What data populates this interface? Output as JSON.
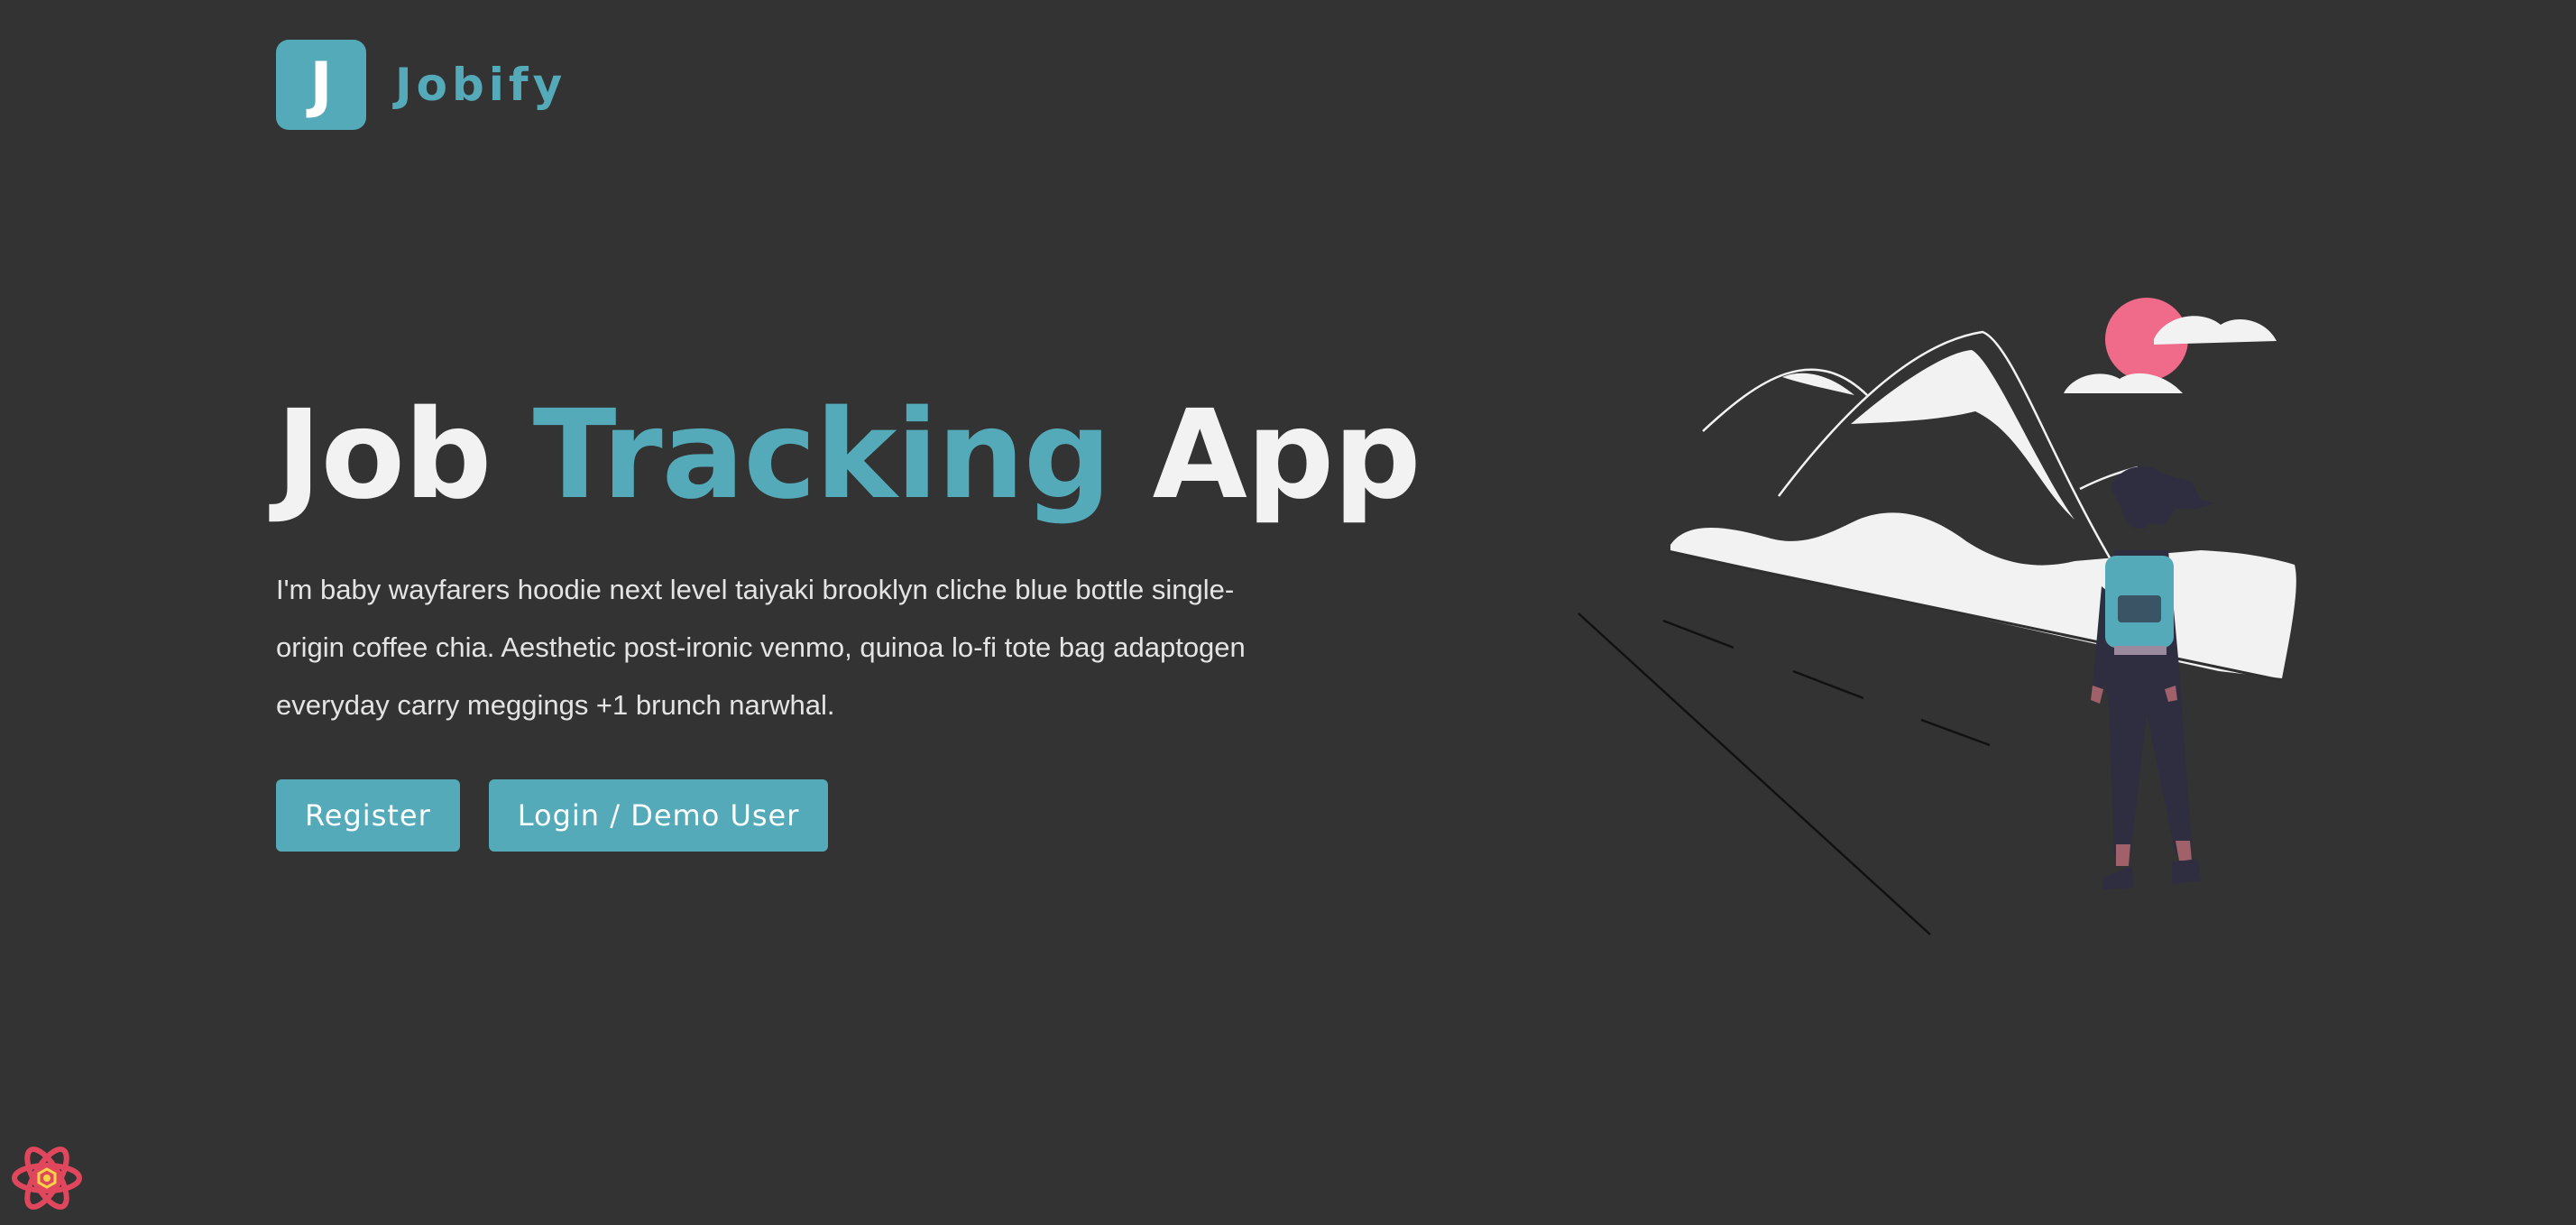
{
  "brand": {
    "logo_letter": "J",
    "name": "Jobify",
    "accent_color": "#54aab8"
  },
  "hero": {
    "title_part1": "Job ",
    "title_accent": "Tracking",
    "title_part2": " App",
    "description": "I'm baby wayfarers hoodie next level taiyaki brooklyn cliche blue bottle single-origin coffee chia. Aesthetic post-ironic venmo, quinoa lo-fi tote bag adaptogen everyday carry meggings +1 brunch narwhal.",
    "register_label": "Register",
    "login_label": "Login / Demo User"
  },
  "illustration": {
    "name": "hiker-mountains-illustration",
    "sun_color": "#f06a8a",
    "figure_color": "#2f2e41",
    "backpack_color": "#54aab8"
  },
  "devtools": {
    "icon": "react-devtools-icon"
  },
  "background_color": "#333333"
}
